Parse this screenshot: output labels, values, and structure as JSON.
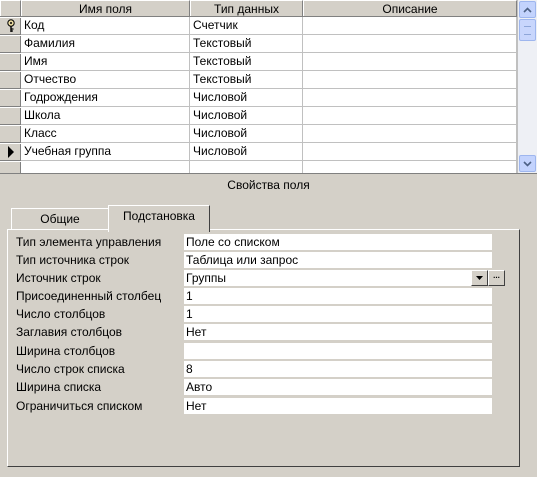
{
  "grid": {
    "headers": {
      "field_name": "Имя поля",
      "data_type": "Тип данных",
      "description": "Описание"
    },
    "rows": [
      {
        "name": "Код",
        "type": "Счетчик",
        "desc": "",
        "marker": "key"
      },
      {
        "name": "Фамилия",
        "type": "Текстовый",
        "desc": ""
      },
      {
        "name": "Имя",
        "type": "Текстовый",
        "desc": ""
      },
      {
        "name": "Отчество",
        "type": "Текстовый",
        "desc": ""
      },
      {
        "name": "Годрождения",
        "type": "Числовой",
        "desc": ""
      },
      {
        "name": "Школа",
        "type": "Числовой",
        "desc": ""
      },
      {
        "name": "Класс",
        "type": "Числовой",
        "desc": ""
      },
      {
        "name": "Учебная группа",
        "type": "Числовой",
        "desc": "",
        "marker": "current"
      },
      {
        "name": "",
        "type": "",
        "desc": ""
      }
    ]
  },
  "properties": {
    "title": "Свойства поля",
    "tabs": {
      "general": "Общие",
      "lookup": "Подстановка"
    },
    "active_tab": "lookup",
    "rows": [
      {
        "label": "Тип элемента управления",
        "value": "Поле со списком"
      },
      {
        "label": "Тип источника строк",
        "value": "Таблица или запрос"
      },
      {
        "label": "Источник строк",
        "value": "Группы"
      },
      {
        "label": "Присоединенный столбец",
        "value": "1"
      },
      {
        "label": "Число столбцов",
        "value": "1"
      },
      {
        "label": "Заглавия столбцов",
        "value": "Нет"
      },
      {
        "label": "Ширина столбцов",
        "value": ""
      },
      {
        "label": "Число строк списка",
        "value": "8"
      },
      {
        "label": "Ширина списка",
        "value": "Авто"
      },
      {
        "label": "Ограничиться списком",
        "value": "Нет"
      }
    ],
    "builder_button": "..."
  },
  "icons": {
    "key": "key-icon",
    "current": "current-row-arrow-icon",
    "dropdown": "dropdown-arrow-icon"
  }
}
